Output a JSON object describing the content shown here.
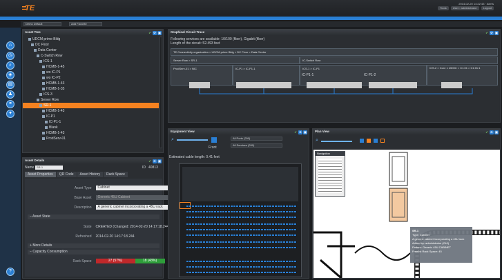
{
  "header": {
    "logo": "TE",
    "line1": "2014-02-20 14:22:43 · Alerts",
    "tools": "Tools",
    "user": "User : administrator",
    "logout": "Logout"
  },
  "toolbar": {
    "group": "Demo Default",
    "favorite": "Add Favorite"
  },
  "asset_tree": {
    "title": "Asset Tree",
    "items": [
      "UDCM prime Bldg",
      "DC Floor",
      "Data Center",
      "C-Switch Row",
      "ICS-1",
      "HCMB-1-45",
      "wo IC-P1",
      "wo IC-P2",
      "HCMB-1-43",
      "HCMB-1-35",
      "ICS-3",
      "Server Row",
      "SR-1",
      "HCMB-1-43",
      "IC-P1",
      "IC-P1-1",
      "Blank",
      "HCMB-1-43",
      "ProdServ-01"
    ],
    "selected_index": 12
  },
  "asset_details": {
    "title": "Asset Details",
    "name_label": "Name",
    "name_value": "SR-1",
    "id_label": "ID",
    "id_value": "40813",
    "tabs": [
      "Asset Properties",
      "QR Code",
      "Asset History",
      "Rack Space"
    ],
    "fields": [
      {
        "label": "Asset Type",
        "value": "Cabinet"
      },
      {
        "label": "Base Asset",
        "value": "Generic 45U Cabinet"
      },
      {
        "label": "Description",
        "value": "A generic cabinet incorporating a 45U rack"
      }
    ],
    "state_header": "Asset State",
    "state": {
      "label": "State",
      "value": "CREATED (Changed: 2014-02-20 14:17:18.244)"
    },
    "refreshed": {
      "label": "Refreshed",
      "value": "2014-02-20 14:17:18.244"
    },
    "more": "More Details",
    "capacity_header": "Capacity Consumption",
    "rack_space": {
      "label": "Rack Space",
      "used_text": "27 (57%)",
      "free_text": "18 (43%)",
      "used_fraction": 0.57
    }
  },
  "circuit": {
    "title": "Graphical Circuit Trace",
    "line1": "Following services are available: 10/100 (fiber), Gigabit (fiber)",
    "line2": "Length of the circuit: 52.493 feet",
    "breadcrumb": "TE Connectivity organization  >  UDCM prime Bldg  >  DC Floor  >  Data Center",
    "server_row": "Server Row  >  SR-1",
    "switch_row": "IC-Switch Row",
    "prodserv": "ProdServ-01  >  NIC",
    "icp": "IC-P1  >  IC-P1-1",
    "ics": "ICS-1  >  IC-P1",
    "core": "ICS-2  >  Core 1 4500C  >  C1:01  >  C1:01:1",
    "icp1": "IC-P1-1",
    "icp2": "IC-P1-2"
  },
  "equipment": {
    "title": "Equipment View",
    "ports": "All Ports (200)",
    "services": "All Services (200)",
    "front": "Front",
    "cable": "Estimated cable length: 0.41 feet"
  },
  "plan": {
    "title": "Plan View",
    "navigation": "Navigation",
    "tip_title": "SR-1",
    "tip_type": "Type: Cabinet",
    "tip_desc": "A generic cabinet incorporating a 45U rack",
    "tip_user": "Added by: administrator (GUI)",
    "tip_pattern": "Pattern: Generic 45U CABINET",
    "tip_free": "Free/lst Rack Space: 45"
  },
  "colors": {
    "accent": "#f58220",
    "blue": "#2a7fd4",
    "used": "#c0282a",
    "free": "#2e9e3a"
  }
}
